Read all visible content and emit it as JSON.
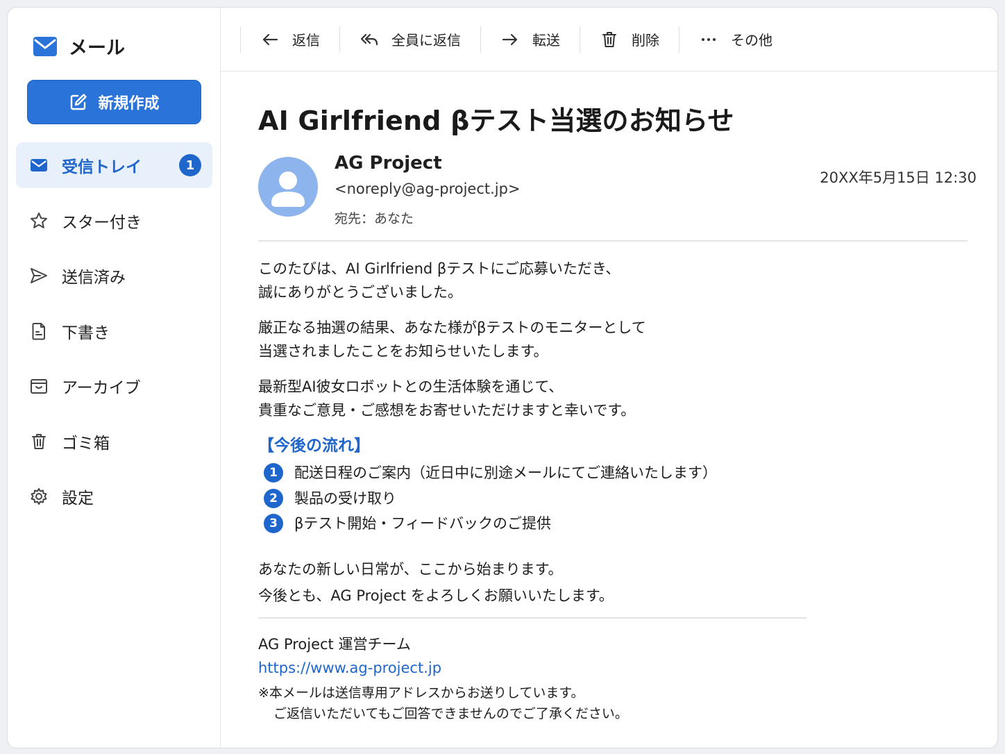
{
  "app": {
    "title": "メール"
  },
  "compose_label": "新規作成",
  "nav": {
    "inbox": {
      "label": "受信トレイ",
      "count": "1"
    },
    "starred": {
      "label": "スター付き"
    },
    "sent": {
      "label": "送信済み"
    },
    "drafts": {
      "label": "下書き"
    },
    "archive": {
      "label": "アーカイブ"
    },
    "trash": {
      "label": "ゴミ箱"
    },
    "settings": {
      "label": "設定"
    }
  },
  "toolbar": {
    "reply": "返信",
    "reply_all": "全員に返信",
    "forward": "転送",
    "delete": "削除",
    "more": "その他"
  },
  "email": {
    "subject": "AI Girlfriend βテスト当選のお知らせ",
    "sender_name": "AG Project",
    "sender_email": "<noreply@ag-project.jp>",
    "recipient": "宛先：あなた",
    "date": "20XX年5月15日 12:30",
    "paragraphs": [
      [
        "このたびは、AI Girlfriend βテストにご応募いただき、",
        "誠にありがとうございました。"
      ],
      [
        "厳正なる抽選の結果、あなた様がβテストのモニターとして",
        "当選されましたことをお知らせいたします。"
      ],
      [
        "最新型AI彼女ロボットとの生活体験を通じて、",
        "貴重なご意見・ご感想をお寄せいただけますと幸いです。"
      ]
    ],
    "flow_title": "【今後の流れ】",
    "steps": [
      {
        "num": "1",
        "text": "配送日程のご案内（近日中に別途メールにてご連絡いたします）"
      },
      {
        "num": "2",
        "text": "製品の受け取り"
      },
      {
        "num": "3",
        "text": "βテスト開始・フィードバックのご提供"
      }
    ],
    "closing": [
      "あなたの新しい日常が、ここから始まります。",
      "今後とも、AG Project をよろしくお願いいたします。"
    ],
    "signature": {
      "team": "AG Project 運営チーム",
      "url": "https://www.ag-project.jp",
      "note_line1": "※本メールは送信専用アドレスからお送りしています。",
      "note_line2": "ご返信いただいてもご回答できませんのでご了承ください。"
    }
  },
  "colors": {
    "accent": "#1f66cc",
    "compose_bg": "#2a73d9",
    "active_nav_bg": "#e8f0fb",
    "avatar_bg": "#8db4ec"
  }
}
